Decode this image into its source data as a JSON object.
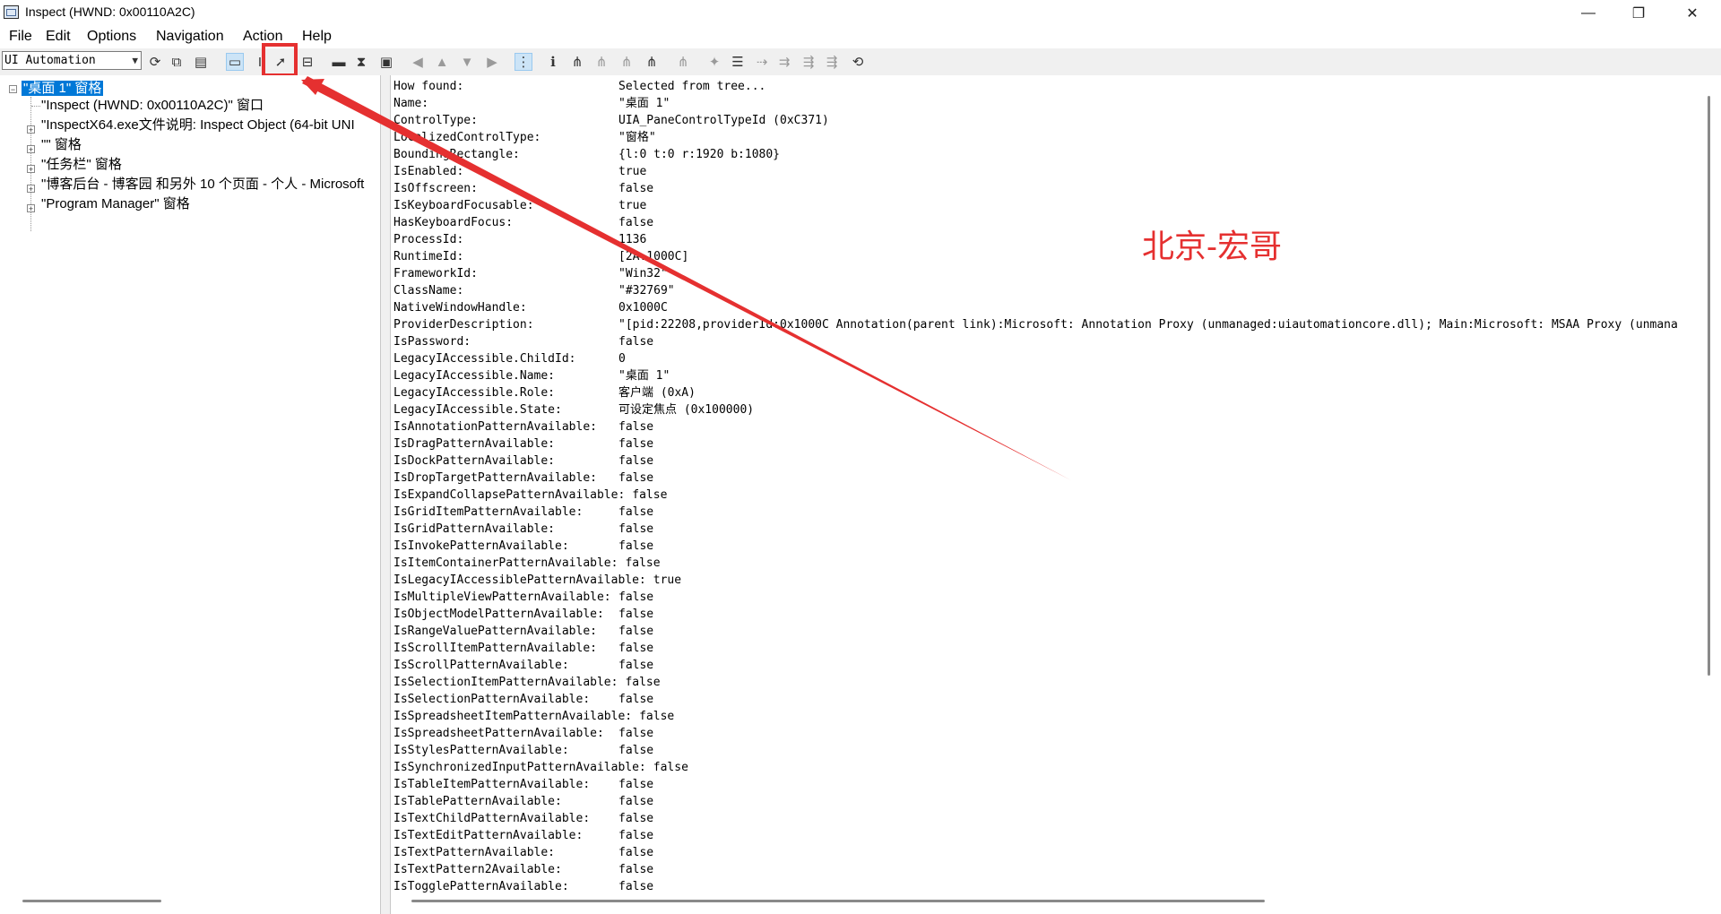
{
  "window": {
    "title": "Inspect  (HWND: 0x00110A2C)",
    "minimize_glyph": "—",
    "maximize_glyph": "❐",
    "close_glyph": "✕"
  },
  "menu": [
    "File",
    "Edit",
    "Options",
    "Navigation",
    "Action",
    "Help"
  ],
  "toolbar": {
    "mode_select": "UI Automation",
    "icons": [
      "refresh-icon",
      "copy-icon",
      "properties-icon",
      "rectangle-icon",
      "text-cursor-icon",
      "pointer-select-icon",
      "watch-tooltip-icon",
      "highlight-icon",
      "hourglass-icon",
      "caret-icon",
      "nav-back-icon",
      "nav-parent-icon",
      "nav-first-child-icon",
      "nav-next-icon",
      "tree-view-icon",
      "info-icon",
      "tree-parent-icon",
      "tree-child-icon",
      "tree-sibling-icon",
      "tree-last-icon",
      "tree-root-icon",
      "focus-tracking-icon",
      "mouse-tracking-icon",
      "caret-tracking-icon",
      "action-dot-icon",
      "action-expand-icon",
      "action-toggle-icon",
      "refresh-tree-icon"
    ]
  },
  "tree": {
    "root": "\"桌面 1\" 窗格",
    "children": [
      {
        "label": "\"Inspect  (HWND: 0x00110A2C)\" 窗口",
        "expandable": false
      },
      {
        "label": "\"InspectX64.exe文件说明: Inspect Object (64-bit UNI",
        "expandable": true
      },
      {
        "label": "\"\" 窗格",
        "expandable": true
      },
      {
        "label": "\"任务栏\" 窗格",
        "expandable": true
      },
      {
        "label": "\"博客后台 - 博客园 和另外 10 个页面 - 个人 - Microsoft",
        "expandable": true
      },
      {
        "label": "\"Program Manager\" 窗格",
        "expandable": true
      }
    ]
  },
  "properties": [
    {
      "name": "How found:",
      "value": "Selected from tree..."
    },
    {
      "name": "Name:",
      "value": "\"桌面 1\""
    },
    {
      "name": "ControlType:",
      "value": "UIA_PaneControlTypeId (0xC371)"
    },
    {
      "name": "LocalizedControlType:",
      "value": "\"窗格\""
    },
    {
      "name": "BoundingRectangle:",
      "value": "{l:0 t:0 r:1920 b:1080}"
    },
    {
      "name": "IsEnabled:",
      "value": "true"
    },
    {
      "name": "IsOffscreen:",
      "value": "false"
    },
    {
      "name": "IsKeyboardFocusable:",
      "value": "true"
    },
    {
      "name": "HasKeyboardFocus:",
      "value": "false"
    },
    {
      "name": "ProcessId:",
      "value": "1136"
    },
    {
      "name": "RuntimeId:",
      "value": "[2A.1000C]"
    },
    {
      "name": "FrameworkId:",
      "value": "\"Win32\""
    },
    {
      "name": "ClassName:",
      "value": "\"#32769\""
    },
    {
      "name": "NativeWindowHandle:",
      "value": "0x1000C"
    },
    {
      "name": "ProviderDescription:",
      "value": "\"[pid:22208,providerId:0x1000C Annotation(parent link):Microsoft: Annotation Proxy (unmanaged:uiautomationcore.dll); Main:Microsoft: MSAA Proxy (unmana"
    },
    {
      "name": "IsPassword:",
      "value": "false"
    },
    {
      "name": "LegacyIAccessible.ChildId:",
      "value": "0"
    },
    {
      "name": "LegacyIAccessible.Name:",
      "value": "\"桌面 1\""
    },
    {
      "name": "LegacyIAccessible.Role:",
      "value": "客户端 (0xA)"
    },
    {
      "name": "LegacyIAccessible.State:",
      "value": "可设定焦点 (0x100000)"
    },
    {
      "name": "IsAnnotationPatternAvailable:",
      "value": "false"
    },
    {
      "name": "IsDragPatternAvailable:",
      "value": "false"
    },
    {
      "name": "IsDockPatternAvailable:",
      "value": "false"
    },
    {
      "name": "IsDropTargetPatternAvailable:",
      "value": "false"
    },
    {
      "name": "IsExpandCollapsePatternAvailable:",
      "value": "false"
    },
    {
      "name": "IsGridItemPatternAvailable:",
      "value": "false"
    },
    {
      "name": "IsGridPatternAvailable:",
      "value": "false"
    },
    {
      "name": "IsInvokePatternAvailable:",
      "value": "false"
    },
    {
      "name": "IsItemContainerPatternAvailable:",
      "value": "false"
    },
    {
      "name": "IsLegacyIAccessiblePatternAvailable:",
      "value": "true"
    },
    {
      "name": "IsMultipleViewPatternAvailable:",
      "value": "false"
    },
    {
      "name": "IsObjectModelPatternAvailable:",
      "value": "false"
    },
    {
      "name": "IsRangeValuePatternAvailable:",
      "value": "false"
    },
    {
      "name": "IsScrollItemPatternAvailable:",
      "value": "false"
    },
    {
      "name": "IsScrollPatternAvailable:",
      "value": "false"
    },
    {
      "name": "IsSelectionItemPatternAvailable:",
      "value": "false"
    },
    {
      "name": "IsSelectionPatternAvailable:",
      "value": "false"
    },
    {
      "name": "IsSpreadsheetItemPatternAvailable:",
      "value": "false"
    },
    {
      "name": "IsSpreadsheetPatternAvailable:",
      "value": "false"
    },
    {
      "name": "IsStylesPatternAvailable:",
      "value": "false"
    },
    {
      "name": "IsSynchronizedInputPatternAvailable:",
      "value": "false"
    },
    {
      "name": "IsTableItemPatternAvailable:",
      "value": "false"
    },
    {
      "name": "IsTablePatternAvailable:",
      "value": "false"
    },
    {
      "name": "IsTextChildPatternAvailable:",
      "value": "false"
    },
    {
      "name": "IsTextEditPatternAvailable:",
      "value": "false"
    },
    {
      "name": "IsTextPatternAvailable:",
      "value": "false"
    },
    {
      "name": "IsTextPattern2Available:",
      "value": "false"
    },
    {
      "name": "IsTogglePatternAvailable:",
      "value": "false"
    }
  ],
  "annotation": {
    "watermark": "北京-宏哥",
    "color": "#e53030"
  }
}
